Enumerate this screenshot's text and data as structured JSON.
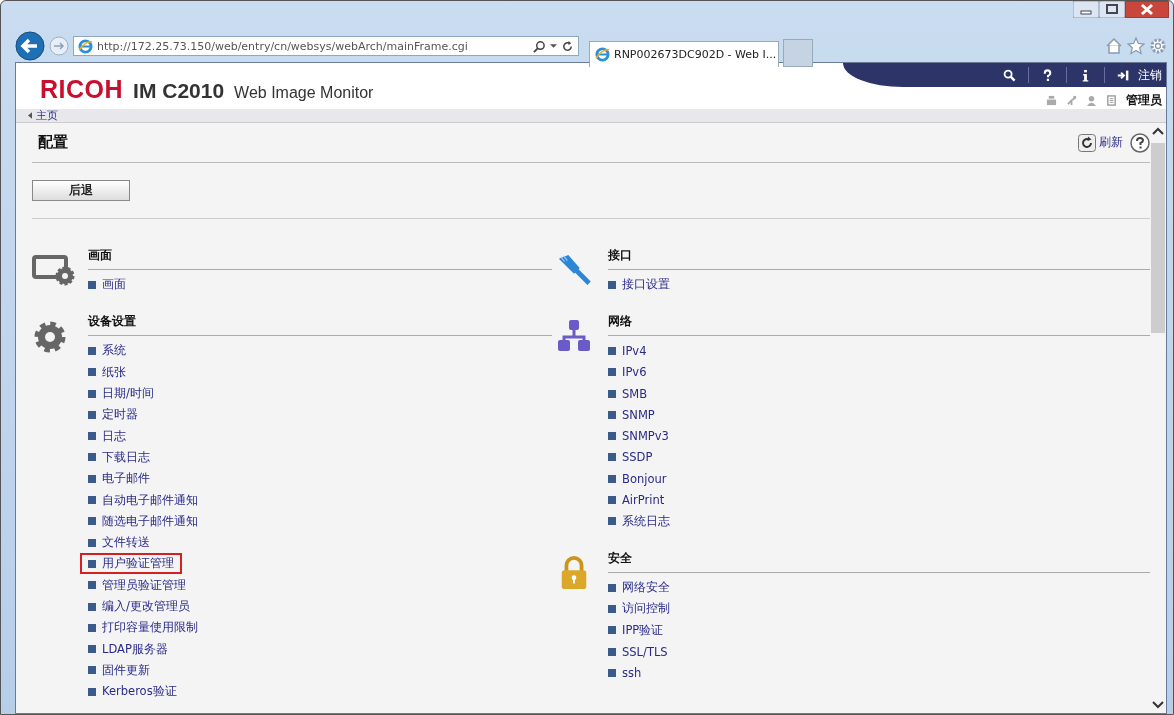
{
  "browser": {
    "url": "http://172.25.73.150/web/entry/cn/websys/webArch/mainFrame.cgi",
    "tab_title": "RNP002673DC902D - Web I..."
  },
  "header": {
    "brand": "RICOH",
    "model": "IM C2010",
    "product": "Web Image Monitor",
    "logout": "注销",
    "user": "管理员"
  },
  "breadcrumb": "主页",
  "page": {
    "title": "配置",
    "refresh": "刷新",
    "back_button": "后退"
  },
  "columns": [
    [
      {
        "title": "画面",
        "items": [
          {
            "label": "画面",
            "highlighted": false
          }
        ]
      },
      {
        "title": "设备设置",
        "items": [
          {
            "label": "系统",
            "highlighted": false
          },
          {
            "label": "纸张",
            "highlighted": false
          },
          {
            "label": "日期/时间",
            "highlighted": false
          },
          {
            "label": "定时器",
            "highlighted": false
          },
          {
            "label": "日志",
            "highlighted": false
          },
          {
            "label": "下载日志",
            "highlighted": false
          },
          {
            "label": "电子邮件",
            "highlighted": false
          },
          {
            "label": "自动电子邮件通知",
            "highlighted": false
          },
          {
            "label": "随选电子邮件通知",
            "highlighted": false
          },
          {
            "label": "文件转送",
            "highlighted": false
          },
          {
            "label": "用户验证管理",
            "highlighted": true
          },
          {
            "label": "管理员验证管理",
            "highlighted": false
          },
          {
            "label": "编入/更改管理员",
            "highlighted": false
          },
          {
            "label": "打印容量使用限制",
            "highlighted": false
          },
          {
            "label": "LDAP服务器",
            "highlighted": false
          },
          {
            "label": "固件更新",
            "highlighted": false
          },
          {
            "label": "Kerberos验证",
            "highlighted": false
          }
        ]
      }
    ],
    [
      {
        "title": "接口",
        "items": [
          {
            "label": "接口设置",
            "highlighted": false
          }
        ]
      },
      {
        "title": "网络",
        "items": [
          {
            "label": "IPv4",
            "highlighted": false
          },
          {
            "label": "IPv6",
            "highlighted": false
          },
          {
            "label": "SMB",
            "highlighted": false
          },
          {
            "label": "SNMP",
            "highlighted": false
          },
          {
            "label": "SNMPv3",
            "highlighted": false
          },
          {
            "label": "SSDP",
            "highlighted": false
          },
          {
            "label": "Bonjour",
            "highlighted": false
          },
          {
            "label": "AirPrint",
            "highlighted": false
          },
          {
            "label": "系统日志",
            "highlighted": false
          }
        ]
      },
      {
        "title": "安全",
        "items": [
          {
            "label": "网络安全",
            "highlighted": false
          },
          {
            "label": "访问控制",
            "highlighted": false
          },
          {
            "label": "IPP验证",
            "highlighted": false
          },
          {
            "label": "SSL/TLS",
            "highlighted": false
          },
          {
            "label": "ssh",
            "highlighted": false
          }
        ]
      }
    ]
  ]
}
